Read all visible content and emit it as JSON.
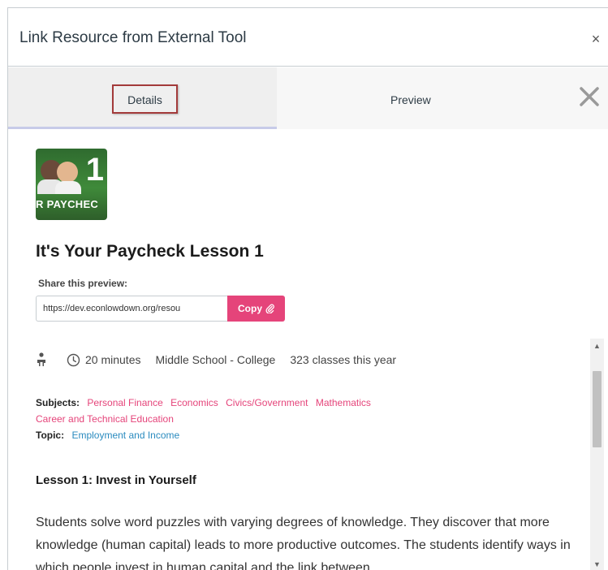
{
  "dialog": {
    "title": "Link Resource from External Tool",
    "close_glyph": "×"
  },
  "tabs": [
    {
      "label": "Details",
      "selected": true
    },
    {
      "label": "Preview",
      "selected": false
    }
  ],
  "resource": {
    "thumbnail_text": "R PAYCHEC",
    "thumbnail_number": "1",
    "title": "It's Your Paycheck Lesson 1",
    "share_label": "Share this preview:",
    "share_url": "https://dev.econlowdown.org/resou",
    "copy_label": "Copy",
    "meta": {
      "duration": "20 minutes",
      "grade": "Middle School - College",
      "classes": "323 classes this year"
    },
    "subjects_label": "Subjects:",
    "subjects": [
      "Personal Finance",
      "Economics",
      "Civics/Government",
      "Mathematics",
      "Career and Technical Education"
    ],
    "topic_label": "Topic:",
    "topic": "Employment and Income",
    "section_heading": "Lesson 1: Invest in Yourself",
    "description": "Students solve word puzzles with varying degrees of knowledge. They discover that more knowledge (human capital) leads to more productive outcomes. The students identify ways in which people invest in human capital and the link between"
  },
  "colors": {
    "accent_pink": "#e5447a",
    "link_blue": "#2a8bbf",
    "focus_outline": "#a33a3a"
  },
  "icons": {
    "dialog_close": "close-icon",
    "tab_close": "close-x-icon",
    "person": "person-icon",
    "clock": "clock-icon",
    "copy": "paperclip-icon"
  }
}
